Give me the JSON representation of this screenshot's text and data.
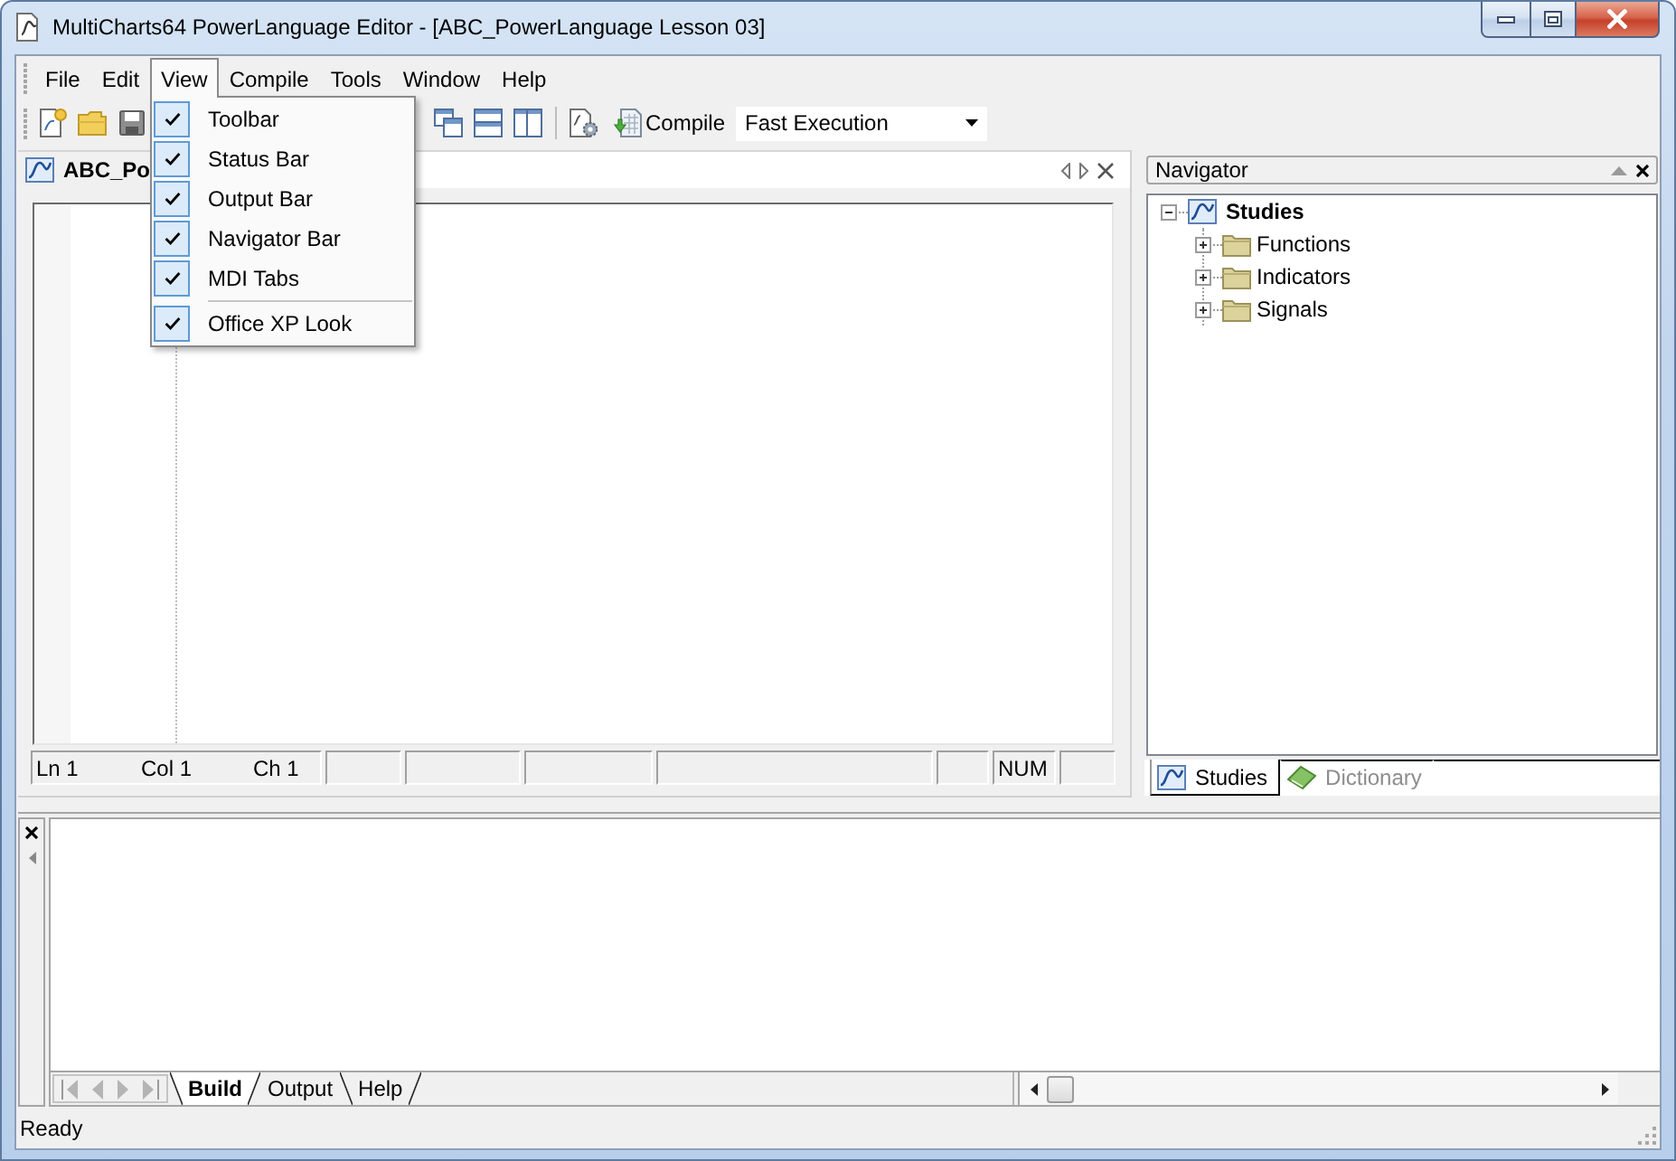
{
  "window": {
    "title": "MultiCharts64 PowerLanguage Editor - [ABC_PowerLanguage Lesson 03]"
  },
  "menu_bar": [
    {
      "label": "File",
      "selected": false
    },
    {
      "label": "Edit",
      "selected": false
    },
    {
      "label": "View",
      "selected": true
    },
    {
      "label": "Compile",
      "selected": false
    },
    {
      "label": "Tools",
      "selected": false
    },
    {
      "label": "Window",
      "selected": false
    },
    {
      "label": "Help",
      "selected": false
    }
  ],
  "view_menu": {
    "groups": [
      [
        {
          "label": "Toolbar",
          "checked": true
        },
        {
          "label": "Status Bar",
          "checked": true
        },
        {
          "label": "Output Bar",
          "checked": true
        },
        {
          "label": "Navigator Bar",
          "checked": true
        },
        {
          "label": "MDI Tabs",
          "checked": true
        }
      ],
      [
        {
          "label": "Office XP Look",
          "checked": true
        }
      ]
    ]
  },
  "toolbar": {
    "compile_button": {
      "label": "Compile"
    },
    "mode_select": {
      "value": "Fast Execution"
    }
  },
  "editor": {
    "tab": {
      "title": "ABC_Po"
    },
    "status": {
      "line": "Ln 1",
      "column": "Col 1",
      "char": "Ch 1",
      "num_lock": "NUM"
    }
  },
  "navigator": {
    "title": "Navigator",
    "tree": [
      {
        "label": "Studies",
        "expanded": true,
        "children": [
          {
            "label": "Functions",
            "expanded": false
          },
          {
            "label": "Indicators",
            "expanded": false
          },
          {
            "label": "Signals",
            "expanded": false
          }
        ]
      }
    ],
    "tabs": [
      {
        "label": "Studies",
        "selected": true
      },
      {
        "label": "Dictionary",
        "selected": false
      }
    ]
  },
  "output": {
    "tabs": [
      {
        "label": "Build",
        "selected": true
      },
      {
        "label": "Output",
        "selected": false
      },
      {
        "label": "Help",
        "selected": false
      }
    ]
  },
  "status_bar": {
    "text": "Ready"
  }
}
